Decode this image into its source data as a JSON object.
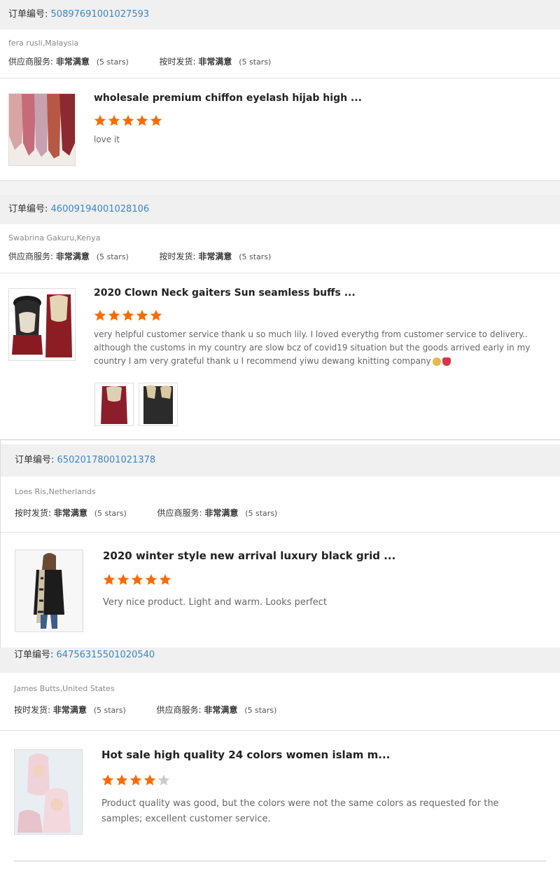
{
  "labels": {
    "order_no": "订单编号:",
    "supplier_service": "供应商服务:",
    "on_time_shipping": "按时发货:",
    "very_satisfied": "非常满意",
    "five_stars": "(5 stars)"
  },
  "colors": {
    "star_on": "#ff6a00",
    "star_off": "#cccccc",
    "order_link": "#3a87c9"
  },
  "reviews": [
    {
      "order_number": "50897691001027593",
      "buyer": "fera rusli,Malaysia",
      "rating_1_label": "供应商服务:",
      "rating_1_value": "非常满意",
      "rating_1_stars": "(5 stars)",
      "rating_2_label": "按时发货:",
      "rating_2_value": "非常满意",
      "rating_2_stars": "(5 stars)",
      "product_title": "wholesale premium chiffon eyelash hijab high ...",
      "stars": 5,
      "comment": "love it"
    },
    {
      "order_number": "46009194001028106",
      "buyer": "Swabrina Gakuru,Kenya",
      "rating_1_label": "供应商服务:",
      "rating_1_value": "非常满意",
      "rating_1_stars": "(5 stars)",
      "rating_2_label": "按时发货:",
      "rating_2_value": "非常满意",
      "rating_2_stars": "(5 stars)",
      "product_title": "2020 Clown Neck gaiters Sun seamless buffs ...",
      "stars": 5,
      "comment": "very helpful customer service thank u so much lily. I loved everythg from customer service to delivery..although the customs in my country are slow bcz of covid19 situation but the goods arrived early in my country I am very grateful thank u I recommend yiwu dewang knitting company"
    },
    {
      "order_number": "65020178001021378",
      "buyer": "Loes Ris,Netherlands",
      "rating_1_label": "按时发货:",
      "rating_1_value": "非常满意",
      "rating_1_stars": "(5 stars)",
      "rating_2_label": "供应商服务:",
      "rating_2_value": "非常满意",
      "rating_2_stars": "(5 stars)",
      "product_title": "2020 winter style new arrival luxury black grid ...",
      "stars": 5,
      "comment": "Very nice product. Light and warm. Looks perfect"
    },
    {
      "order_number": "64756315501020540",
      "buyer": "James Butts,United States",
      "rating_1_label": "按时发货:",
      "rating_1_value": "非常满意",
      "rating_1_stars": "(5 stars)",
      "rating_2_label": "供应商服务:",
      "rating_2_value": "非常满意",
      "rating_2_stars": "(5 stars)",
      "product_title": "Hot sale high quality 24 colors women islam m...",
      "stars": 4,
      "comment": "Product quality was good, but the colors were not the same colors as requested for the samples; excellent customer service."
    }
  ]
}
